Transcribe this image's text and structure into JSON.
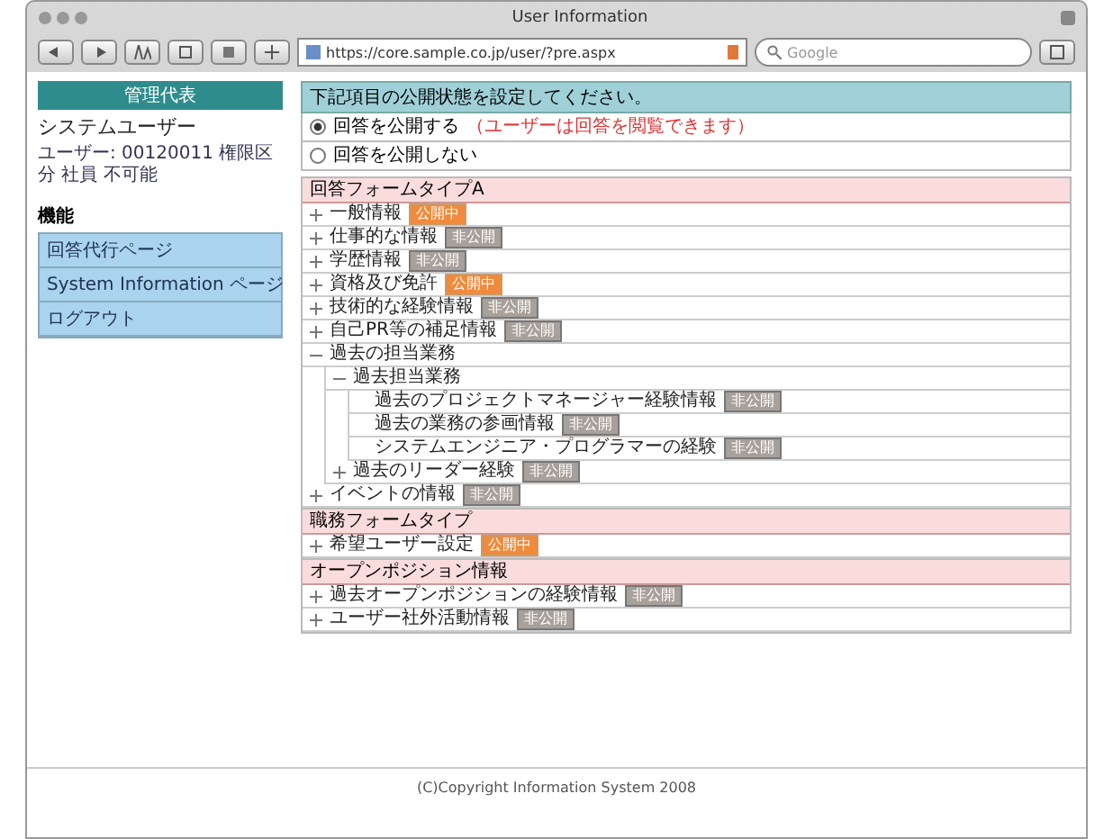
{
  "window": {
    "title": "User Information"
  },
  "toolbar": {
    "url": "https://core.sample.co.jp/user/?pre.aspx",
    "search_placeholder": "Google"
  },
  "sidebar": {
    "header": "管理代表",
    "user_name": "システムユーザー",
    "user_info": "ユーザー: 00120011 権限区分 社員 不可能",
    "menu_title": "機能",
    "menu": [
      {
        "label": "回答代行ページ"
      },
      {
        "label": "System Information ページ"
      },
      {
        "label": "ログアウト"
      }
    ]
  },
  "main": {
    "instruction": "下記項目の公開状態を設定してください。",
    "options": [
      {
        "label": "回答を公開する",
        "note": "（ユーザーは回答を閲覧できます）",
        "selected": true
      },
      {
        "label": "回答を公開しない",
        "selected": false
      }
    ],
    "sections": [
      {
        "title": "回答フォームタイプA",
        "items": [
          {
            "label": "一般情報",
            "expanded": false,
            "badge": {
              "text": "公開中",
              "published": true
            }
          },
          {
            "label": "仕事的な情報",
            "expanded": false,
            "badge": {
              "text": "非公開",
              "published": false
            }
          },
          {
            "label": "学歴情報",
            "expanded": false,
            "badge": {
              "text": "非公開",
              "published": false
            }
          },
          {
            "label": "資格及び免許",
            "expanded": false,
            "badge": {
              "text": "公開中",
              "published": true
            }
          },
          {
            "label": "技術的な経験情報",
            "expanded": false,
            "badge": {
              "text": "非公開",
              "published": false
            }
          },
          {
            "label": "自己PR等の補足情報",
            "expanded": false,
            "badge": {
              "text": "非公開",
              "published": false
            }
          },
          {
            "label": "過去の担当業務",
            "expanded": true,
            "children": [
              {
                "label": "過去担当業務",
                "expanded": true,
                "children": [
                  {
                    "label": "過去のプロジェクトマネージャー経験情報",
                    "badge": {
                      "text": "非公開",
                      "published": false
                    }
                  },
                  {
                    "label": "過去の業務の参画情報",
                    "badge": {
                      "text": "非公開",
                      "published": false
                    }
                  },
                  {
                    "label": "システムエンジニア・プログラマーの経験",
                    "badge": {
                      "text": "非公開",
                      "published": false
                    }
                  }
                ]
              },
              {
                "label": "過去のリーダー経験",
                "expanded": false,
                "badge": {
                  "text": "非公開",
                  "published": false
                }
              }
            ]
          },
          {
            "label": "イベントの情報",
            "expanded": false,
            "badge": {
              "text": "非公開",
              "published": false
            }
          }
        ]
      },
      {
        "title": "職務フォームタイプ",
        "items": [
          {
            "label": "希望ユーザー設定",
            "expanded": false,
            "badge": {
              "text": "公開中",
              "published": true
            }
          }
        ]
      },
      {
        "title": "オープンポジション情報",
        "items": [
          {
            "label": "過去オープンポジションの経験情報",
            "expanded": false,
            "badge": {
              "text": "非公開",
              "published": false
            }
          },
          {
            "label": "ユーザー社外活動情報",
            "expanded": false,
            "badge": {
              "text": "非公開",
              "published": false
            }
          }
        ]
      }
    ]
  },
  "footer": "(C)Copyright Information System 2008"
}
